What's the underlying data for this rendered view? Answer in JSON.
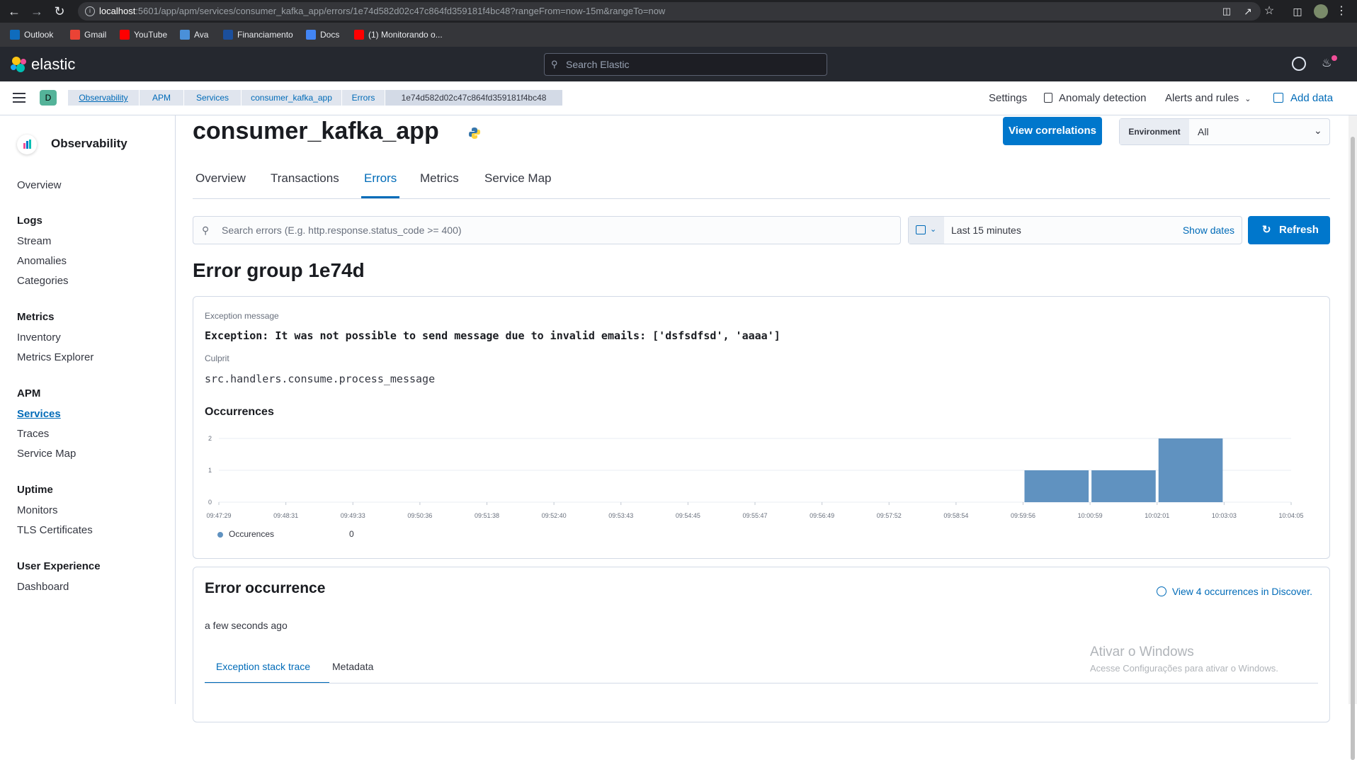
{
  "browser": {
    "url_host": "localhost",
    "url_rest": ":5601/app/apm/services/consumer_kafka_app/errors/1e74d582d02c47c864fd359181f4bc48?rangeFrom=now-15m&rangeTo=now",
    "bookmarks": [
      {
        "label": "Outlook",
        "color": "#0f6cbd"
      },
      {
        "label": "Gmail",
        "color": "#ea4335"
      },
      {
        "label": "YouTube",
        "color": "#ff0000"
      },
      {
        "label": "Ava",
        "color": "#4a90d9"
      },
      {
        "label": "Financiamento",
        "color": "#1b4f9c"
      },
      {
        "label": "Docs",
        "color": "#4285f4"
      },
      {
        "label": "(1) Monitorando o...",
        "color": "#ff0000"
      }
    ]
  },
  "header": {
    "logo_text": "elastic",
    "search_placeholder": "Search Elastic"
  },
  "breadcrumbs": {
    "space_letter": "D",
    "items": [
      "Observability",
      "APM",
      "Services",
      "consumer_kafka_app",
      "Errors",
      "1e74d582d02c47c864fd359181f4bc48"
    ],
    "settings": "Settings",
    "anomaly": "Anomaly detection",
    "alerts": "Alerts and rules",
    "add_data": "Add data"
  },
  "sidebar": {
    "title": "Observability",
    "overview": "Overview",
    "sections": [
      {
        "heading": "Logs",
        "items": [
          "Stream",
          "Anomalies",
          "Categories"
        ]
      },
      {
        "heading": "Metrics",
        "items": [
          "Inventory",
          "Metrics Explorer"
        ]
      },
      {
        "heading": "APM",
        "items": [
          "Services",
          "Traces",
          "Service Map"
        ]
      },
      {
        "heading": "Uptime",
        "items": [
          "Monitors",
          "TLS Certificates"
        ]
      },
      {
        "heading": "User Experience",
        "items": [
          "Dashboard"
        ]
      }
    ],
    "active_item": "Services"
  },
  "page": {
    "service_name": "consumer_kafka_app",
    "view_correlations": "View correlations",
    "environment_label": "Environment",
    "environment_value": "All",
    "tabs": [
      "Overview",
      "Transactions",
      "Errors",
      "Metrics",
      "Service Map"
    ],
    "active_tab": "Errors",
    "search_placeholder": "Search errors (E.g. http.response.status_code >= 400)",
    "date_range": "Last 15 minutes",
    "show_dates": "Show dates",
    "refresh": "Refresh",
    "error_group_title": "Error group 1e74d"
  },
  "error_summary": {
    "exception_label": "Exception message",
    "exception_message": "Exception: It was not possible to send message due to invalid emails: ['dsfsdfsd', 'aaaa']",
    "culprit_label": "Culprit",
    "culprit": "src.handlers.consume.process_message",
    "occurrences_title": "Occurrences",
    "legend_name": "Occurences",
    "legend_value": "0"
  },
  "chart_data": {
    "type": "bar",
    "title": "Occurrences",
    "x_ticks": [
      "09:47:29",
      "09:48:31",
      "09:49:33",
      "09:50:36",
      "09:51:38",
      "09:52:40",
      "09:53:43",
      "09:54:45",
      "09:55:47",
      "09:56:49",
      "09:57:52",
      "09:58:54",
      "09:59:56",
      "10:00:59",
      "10:02:01",
      "10:03:03",
      "10:04:05"
    ],
    "bars": [
      {
        "start_tick": 12,
        "value": 1
      },
      {
        "start_tick": 13,
        "value": 1
      },
      {
        "start_tick": 14,
        "value": 2
      }
    ],
    "y_ticks": [
      0,
      1,
      2
    ],
    "ylim": [
      0,
      2
    ],
    "grid": true,
    "series": [
      {
        "name": "Occurences",
        "color": "#6092c0"
      }
    ]
  },
  "occurrence": {
    "title": "Error occurrence",
    "discover_link": "View 4 occurrences in Discover.",
    "timestamp": "a few seconds ago",
    "tabs": [
      "Exception stack trace",
      "Metadata"
    ],
    "active_tab": "Exception stack trace"
  },
  "watermark": {
    "line1": "Ativar o Windows",
    "line2": "Acesse Configurações para ativar o Windows."
  }
}
